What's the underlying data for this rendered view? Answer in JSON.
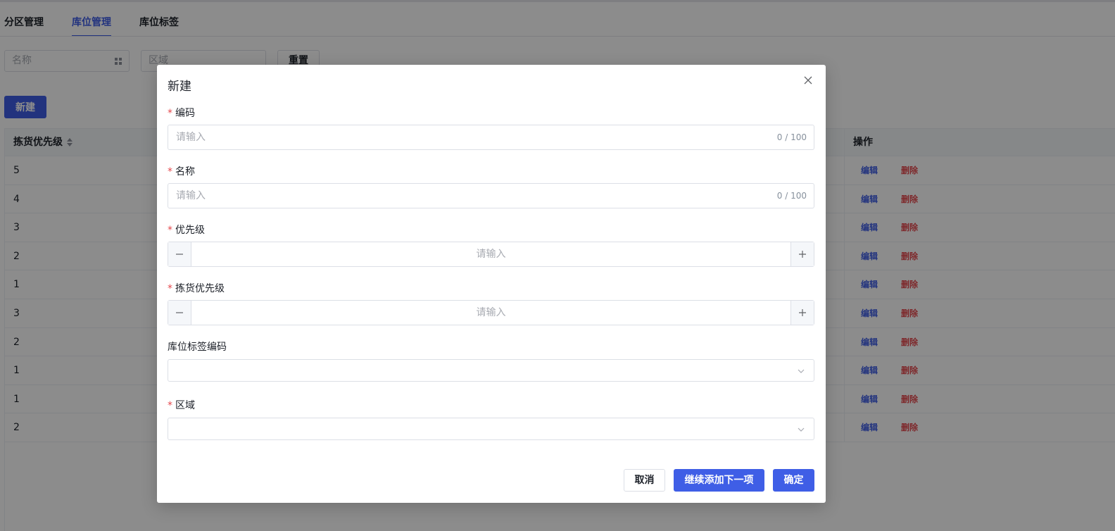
{
  "tabs": [
    {
      "label": "分区管理",
      "active": false
    },
    {
      "label": "库位管理",
      "active": true
    },
    {
      "label": "库位标签",
      "active": false
    }
  ],
  "filters": {
    "name_placeholder": "名称",
    "area_placeholder": "区域",
    "reset_label": "重置"
  },
  "toolbar": {
    "new_label": "新建"
  },
  "table": {
    "columns": [
      "拣货优先级",
      "操作"
    ],
    "rows": [
      {
        "pick_priority": "5",
        "edit": "编辑",
        "delete": "删除"
      },
      {
        "pick_priority": "4",
        "edit": "编辑",
        "delete": "删除"
      },
      {
        "pick_priority": "3",
        "edit": "编辑",
        "delete": "删除"
      },
      {
        "pick_priority": "2",
        "edit": "编辑",
        "delete": "删除"
      },
      {
        "pick_priority": "1",
        "edit": "编辑",
        "delete": "删除"
      },
      {
        "pick_priority": "3",
        "edit": "编辑",
        "delete": "删除"
      },
      {
        "pick_priority": "2",
        "edit": "编辑",
        "delete": "删除"
      },
      {
        "pick_priority": "1",
        "edit": "编辑",
        "delete": "删除"
      },
      {
        "pick_priority": "1",
        "edit": "编辑",
        "delete": "删除"
      },
      {
        "pick_priority": "2",
        "edit": "编辑",
        "delete": "删除"
      }
    ]
  },
  "dialog": {
    "title": "新建",
    "code": {
      "label": "编码",
      "placeholder": "请输入",
      "count": "0 / 100"
    },
    "name": {
      "label": "名称",
      "placeholder": "请输入",
      "count": "0 / 100"
    },
    "priority": {
      "label": "优先级",
      "placeholder": "请输入"
    },
    "pick_priority": {
      "label": "拣货优先级",
      "placeholder": "请输入"
    },
    "tag_code": {
      "label": "库位标签编码"
    },
    "area": {
      "label": "区域"
    },
    "required_mark": "*",
    "cancel_label": "取消",
    "continue_label": "继续添加下一项",
    "ok_label": "确定"
  },
  "colors": {
    "primary": "#3f5ee6",
    "danger": "#e5484d"
  }
}
